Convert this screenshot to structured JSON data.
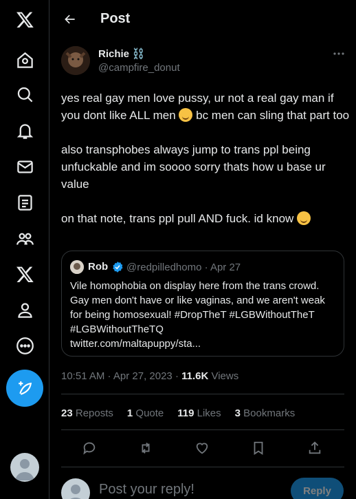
{
  "header": {
    "title": "Post"
  },
  "tweet": {
    "author_name": "Richie ⛓️",
    "author_handle": "@campfire_donut",
    "paragraph1_a": "yes real gay men love pussy, ur not a real gay man if you dont like ALL men",
    "paragraph1_b": " bc men can sling that part too",
    "paragraph2": "also transphobes always jump to trans ppl being unfuckable and im soooo sorry thats how u base ur value",
    "paragraph3": "on that note, trans ppl pull AND fuck. id know",
    "timestamp": "10:51 AM · Apr 27, 2023 · ",
    "views_count": "11.6K",
    "views_label": " Views"
  },
  "quote": {
    "author_name": "Rob",
    "meta": "@redpilledhomo · Apr 27",
    "text": "Vile homophobia on display here from the trans crowd. Gay men don't have or like vaginas, and we aren't weak for being homosexual! #DropTheT #LGBWithoutTheT #LGBWithoutTheTQ\ntwitter.com/maltapuppy/sta..."
  },
  "stats": {
    "reposts_count": "23",
    "reposts_label": " Reposts",
    "quote_count": "1",
    "quote_label": " Quote",
    "likes_count": "119",
    "likes_label": " Likes",
    "bookmarks_count": "3",
    "bookmarks_label": " Bookmarks"
  },
  "reply": {
    "placeholder": "Post your reply!",
    "button": "Reply"
  },
  "nav_icons": [
    "x-logo-icon",
    "home-icon",
    "search-icon",
    "notifications-icon",
    "messages-icon",
    "lists-icon",
    "communities-icon",
    "premium-icon",
    "profile-icon",
    "more-icon",
    "compose-icon"
  ],
  "colors": {
    "accent": "#1d9bf0",
    "background": "#000000",
    "text": "#e7e9ea",
    "muted": "#71767b",
    "border": "#2f3336"
  }
}
